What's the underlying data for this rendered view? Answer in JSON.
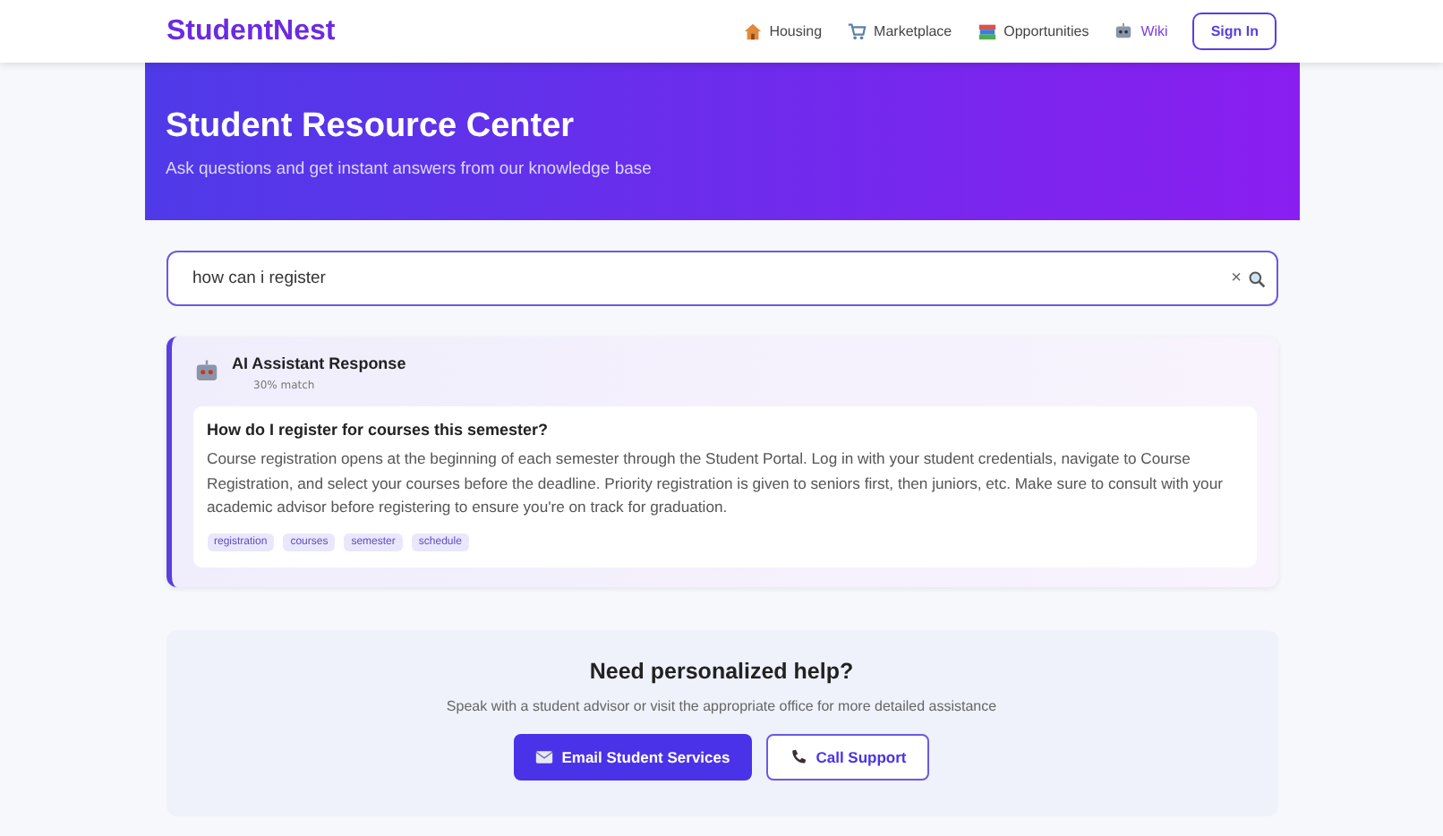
{
  "header": {
    "logo": "StudentNest",
    "nav": [
      {
        "label": "Housing",
        "kind": "house",
        "selected": false
      },
      {
        "label": "Marketplace",
        "kind": "cart",
        "selected": false
      },
      {
        "label": "Opportunities",
        "kind": "books",
        "selected": false
      },
      {
        "label": "Wiki",
        "kind": "robot",
        "selected": true
      }
    ],
    "sign_in": "Sign In"
  },
  "hero": {
    "title": "Student Resource Center",
    "subtitle": "Ask questions and get instant answers from our knowledge base"
  },
  "search": {
    "value": "how can i register",
    "clear": "×"
  },
  "response": {
    "title": "AI Assistant Response",
    "match": "30% match",
    "question": "How do I register for courses this semester?",
    "answer": "Course registration opens at the beginning of each semester through the Student Portal. Log in with your student credentials, navigate to Course Registration, and select your courses before the deadline. Priority registration is given to seniors first, then juniors, etc. Make sure to consult with your academic advisor before registering to ensure you're on track for graduation.",
    "tags": [
      "registration",
      "courses",
      "semester",
      "schedule"
    ]
  },
  "help": {
    "title": "Need personalized help?",
    "text": "Speak with a student advisor or visit the appropriate office for more detailed assistance",
    "buttons": [
      {
        "label": "Email Student Services",
        "kind": "primary"
      },
      {
        "label": "Call Support",
        "kind": "outline"
      }
    ]
  }
}
